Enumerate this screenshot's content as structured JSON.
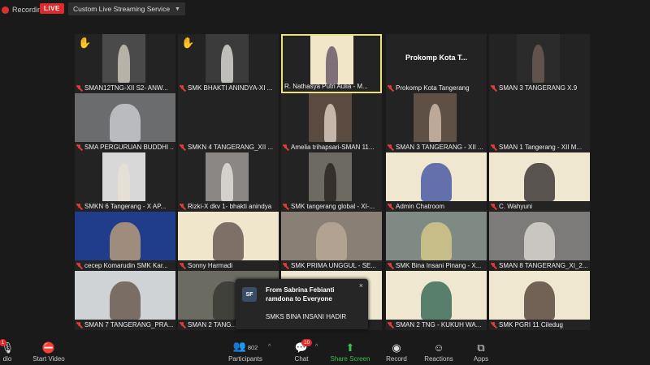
{
  "top": {
    "recording_label": "Recording",
    "live_label": "LIVE",
    "service_label": "Custom Live Streaming Service"
  },
  "colors": {
    "live": "#e02a2a",
    "active_border": "#e9e37c",
    "share": "#3fbf4d",
    "mic_off": "#e23b3b"
  },
  "tiles": [
    {
      "name": "SMAN12TNG-XII S2- ANW...",
      "hand": true,
      "muted": true,
      "active": false,
      "bg": "#4a4a4a",
      "fg": "#c9c4b8"
    },
    {
      "name": "SMK BHAKTI ANINDYA-XI ...",
      "hand": true,
      "muted": true,
      "active": false,
      "bg": "#3b3b3b",
      "fg": "#d8d6d2"
    },
    {
      "name": "R. Nathasya Putri Aulia - M...",
      "hand": false,
      "muted": false,
      "active": true,
      "bg": "#f1e6c8",
      "fg": "#6b5a6a"
    },
    {
      "name": "Prokomp Kota Tangerang",
      "hand": false,
      "muted": true,
      "active": false,
      "bg": "#232323",
      "fg": "#232323",
      "big": "Prokomp Kota T..."
    },
    {
      "name": "SMAN 3 TANGERANG X.9",
      "hand": false,
      "muted": true,
      "active": false,
      "bg": "#2b2b2b",
      "fg": "#6a5a55"
    },
    {
      "name": "SMA PERGURUAN BUDDHI ...",
      "hand": false,
      "muted": true,
      "active": false,
      "bg": "#6b6c6e",
      "fg": "#c7c9cc",
      "wide": true
    },
    {
      "name": "SMKN 4 TANGERANG_XII ...",
      "hand": false,
      "muted": true,
      "active": false,
      "bg": "#232323",
      "fg": "#232323"
    },
    {
      "name": "Amelia trihapsari-SMAN 11...",
      "hand": false,
      "muted": true,
      "active": false,
      "bg": "#5a4a40",
      "fg": "#d9c9bc"
    },
    {
      "name": "SMAN 3 TANGERANG - XII ...",
      "hand": false,
      "muted": true,
      "active": false,
      "bg": "#5f5046",
      "fg": "#cdb9a8"
    },
    {
      "name": "SMAN 1 Tangerang - XII M...",
      "hand": false,
      "muted": true,
      "active": false,
      "bg": "#232323",
      "fg": "#232323"
    },
    {
      "name": "SMKN 6 Tangerang - X AP...",
      "hand": false,
      "muted": true,
      "active": false,
      "bg": "#d8d8d8",
      "fg": "#e9e1d6"
    },
    {
      "name": "Rizki-X dkv 1- bhakti anindya",
      "hand": false,
      "muted": true,
      "active": false,
      "bg": "#8a8784",
      "fg": "#e0ddd8"
    },
    {
      "name": "SMK tangerang global - XI-...",
      "hand": false,
      "muted": true,
      "active": false,
      "bg": "#6d6a62",
      "fg": "#2c2623"
    },
    {
      "name": "Admin Chatroom",
      "hand": false,
      "muted": true,
      "active": false,
      "bg": "#efe7cf",
      "fg": "#4a5aa6",
      "wide": true
    },
    {
      "name": "C. Wahyuni",
      "hand": false,
      "muted": true,
      "active": false,
      "bg": "#efe7cf",
      "fg": "#3e3a3a",
      "wide": true
    },
    {
      "name": "cecep Komarudin SMK Kar...",
      "hand": false,
      "muted": true,
      "active": false,
      "bg": "#1f3d8a",
      "fg": "#b79a7a",
      "wide": true
    },
    {
      "name": "Sonny Harmadi",
      "hand": false,
      "muted": true,
      "active": false,
      "bg": "#f0e6cc",
      "fg": "#6a5a55",
      "wide": true
    },
    {
      "name": "SMK PRIMA UNGGUL - SE...",
      "hand": false,
      "muted": true,
      "active": false,
      "bg": "#8a7f74",
      "fg": "#b7a898",
      "wide": true
    },
    {
      "name": "SMK Bina Insani Pinang - X...",
      "hand": false,
      "muted": true,
      "active": false,
      "bg": "#7f8a84",
      "fg": "#d2c68a",
      "wide": true
    },
    {
      "name": "SMAN 8 TANGERANG_XI_2...",
      "hand": false,
      "muted": true,
      "active": false,
      "bg": "#7d7b79",
      "fg": "#d6d2ce",
      "wide": true
    },
    {
      "name": "SMAN 7 TANGERANG_PRA...",
      "hand": false,
      "muted": true,
      "active": false,
      "bg": "#cfd3d6",
      "fg": "#6a5a50",
      "wide": true
    },
    {
      "name": "SMAN 2 TANG...",
      "hand": false,
      "muted": true,
      "active": false,
      "bg": "#6b6b62",
      "fg": "#3a3a35",
      "wide": true
    },
    {
      "name": "",
      "hand": false,
      "muted": false,
      "active": false,
      "bg": "#efe7cf",
      "fg": "#efe7cf",
      "wide": true
    },
    {
      "name": "SMAN 2 TNG - KUKUH WA...",
      "hand": false,
      "muted": true,
      "active": false,
      "bg": "#efe7cf",
      "fg": "#3d6b5a",
      "wide": true
    },
    {
      "name": "SMK PGRI 11 Ciledug",
      "hand": false,
      "muted": true,
      "active": false,
      "bg": "#efe7cf",
      "fg": "#5a4a40",
      "wide": true
    }
  ],
  "chat_popup": {
    "avatar_initials": "SF",
    "from": "From Sabrina Febianti ramdona to Everyone",
    "message": "SMKS BINA INSANI HADIR",
    "close": "×"
  },
  "toolbar": {
    "audio_label": "dio",
    "audio_badge": "1",
    "start_video": "Start Video",
    "participants": "Participants",
    "participants_count": "802",
    "chat": "Chat",
    "chat_badge": "10",
    "share_screen": "Share Screen",
    "record": "Record",
    "reactions": "Reactions",
    "apps": "Apps"
  }
}
